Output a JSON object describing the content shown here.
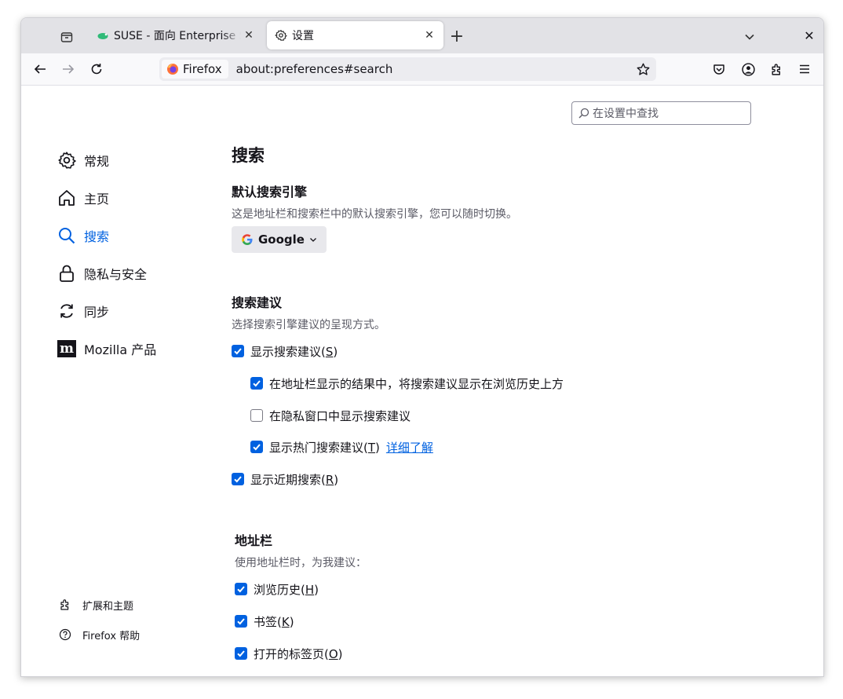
{
  "tabs": [
    {
      "title": "SUSE - 面向 Enterprise Se",
      "favicon": "suse-chameleon-icon",
      "active": false
    },
    {
      "title": "设置",
      "favicon": "gear-icon",
      "active": true
    }
  ],
  "toolbar": {
    "identity_label": "Firefox",
    "url": "about:preferences#search"
  },
  "search": {
    "placeholder": "在设置中查找"
  },
  "sidebar": {
    "items": [
      {
        "label": "常规",
        "icon": "gear-icon"
      },
      {
        "label": "主页",
        "icon": "home-icon"
      },
      {
        "label": "搜索",
        "icon": "search-icon",
        "selected": true
      },
      {
        "label": "隐私与安全",
        "icon": "lock-icon"
      },
      {
        "label": "同步",
        "icon": "sync-icon"
      },
      {
        "label": "Mozilla 产品",
        "icon": "mozilla-icon"
      }
    ],
    "footer": [
      {
        "label": "扩展和主题",
        "icon": "puzzle-icon"
      },
      {
        "label": "Firefox 帮助",
        "icon": "help-icon"
      }
    ]
  },
  "main": {
    "title": "搜索",
    "default_engine": {
      "heading": "默认搜索引擎",
      "description": "这是地址栏和搜索栏中的默认搜索引擎，您可以随时切换。",
      "selected": "Google"
    },
    "suggestions": {
      "heading": "搜索建议",
      "description": "选择搜索引擎建议的呈现方式。",
      "options": [
        {
          "label": "显示搜索建议(",
          "accesskey": "S",
          "suffix": ")",
          "checked": true
        },
        {
          "label": "在地址栏显示的结果中，将搜索建议显示在浏览历史上方",
          "checked": true
        },
        {
          "label": "在隐私窗口中显示搜索建议",
          "checked": false
        },
        {
          "label": "显示热门搜索建议(",
          "accesskey": "T",
          "suffix": ")",
          "checked": true,
          "link": "详细了解"
        },
        {
          "label": "显示近期搜索(",
          "accesskey": "R",
          "suffix": ")",
          "checked": true
        }
      ]
    },
    "address_bar": {
      "heading": "地址栏",
      "description": "使用地址栏时，为我建议：",
      "options": [
        {
          "label": "浏览历史(",
          "accesskey": "H",
          "suffix": ")",
          "checked": true
        },
        {
          "label": "书签(",
          "accesskey": "K",
          "suffix": ")",
          "checked": true
        },
        {
          "label": "打开的标签页(",
          "accesskey": "O",
          "suffix": ")",
          "checked": true
        }
      ]
    }
  },
  "colors": {
    "accent": "#0061e0",
    "tabstrip": "#e2e2e6",
    "text": "#15141a"
  }
}
